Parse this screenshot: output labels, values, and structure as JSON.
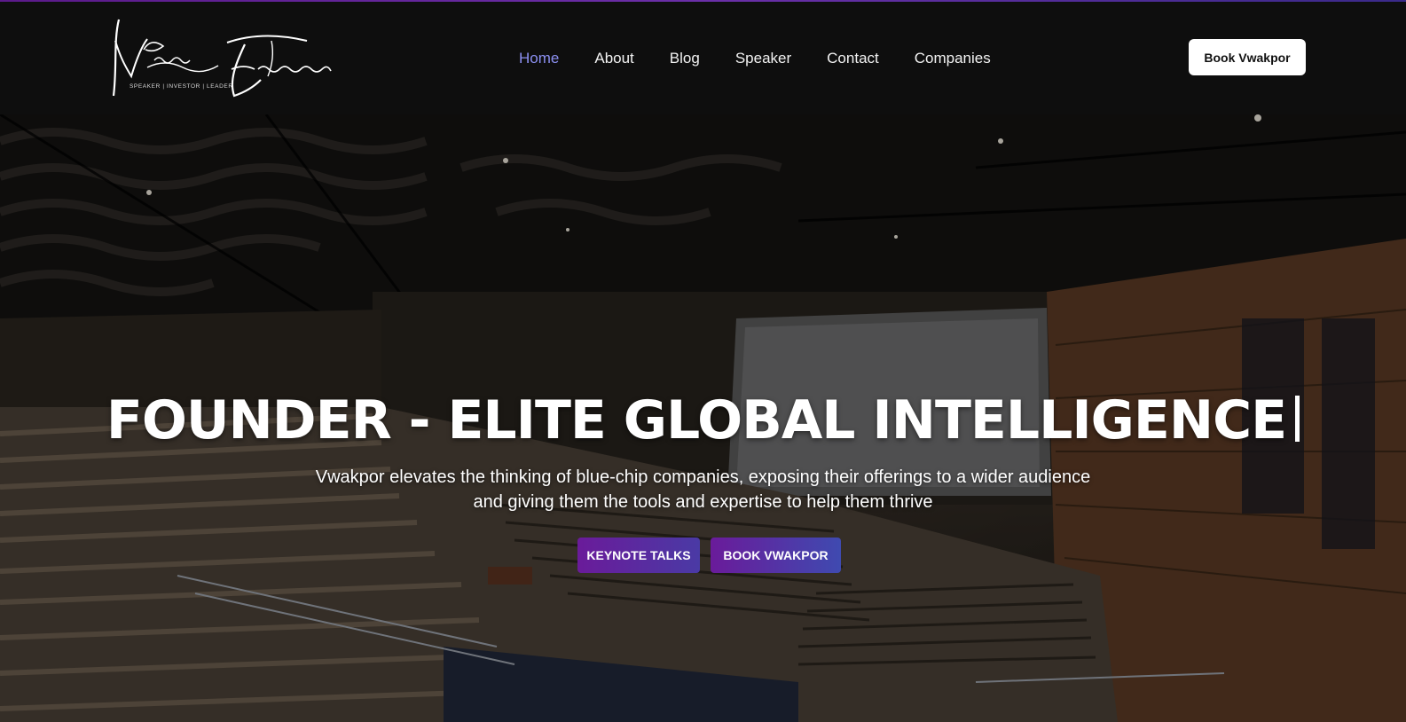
{
  "brand": {
    "name": "Vwakpor Efuetanu",
    "tagline": "SPEAKER | INVESTOR | LEADER"
  },
  "nav": {
    "items": [
      {
        "label": "Home",
        "active": true
      },
      {
        "label": "About"
      },
      {
        "label": "Blog"
      },
      {
        "label": "Speaker"
      },
      {
        "label": "Contact"
      },
      {
        "label": "Companies"
      }
    ],
    "book_label": "Book Vwakpor"
  },
  "hero": {
    "title": "FOUNDER - ELITE GLOBAL INTELLIGENCE",
    "subtitle": "Vwakpor elevates the thinking of blue-chip companies, exposing their offerings to a wider audience and giving them the tools and expertise to help them thrive",
    "cta_primary": "KEYNOTE TALKS",
    "cta_secondary": "BOOK VWAKPOR"
  },
  "colors": {
    "nav_active": "#8b8ff0",
    "cta_gradient_start": "#6a1b9a",
    "cta_gradient_end": "#4a3aa5",
    "header_bg": "#0e0e0e"
  }
}
